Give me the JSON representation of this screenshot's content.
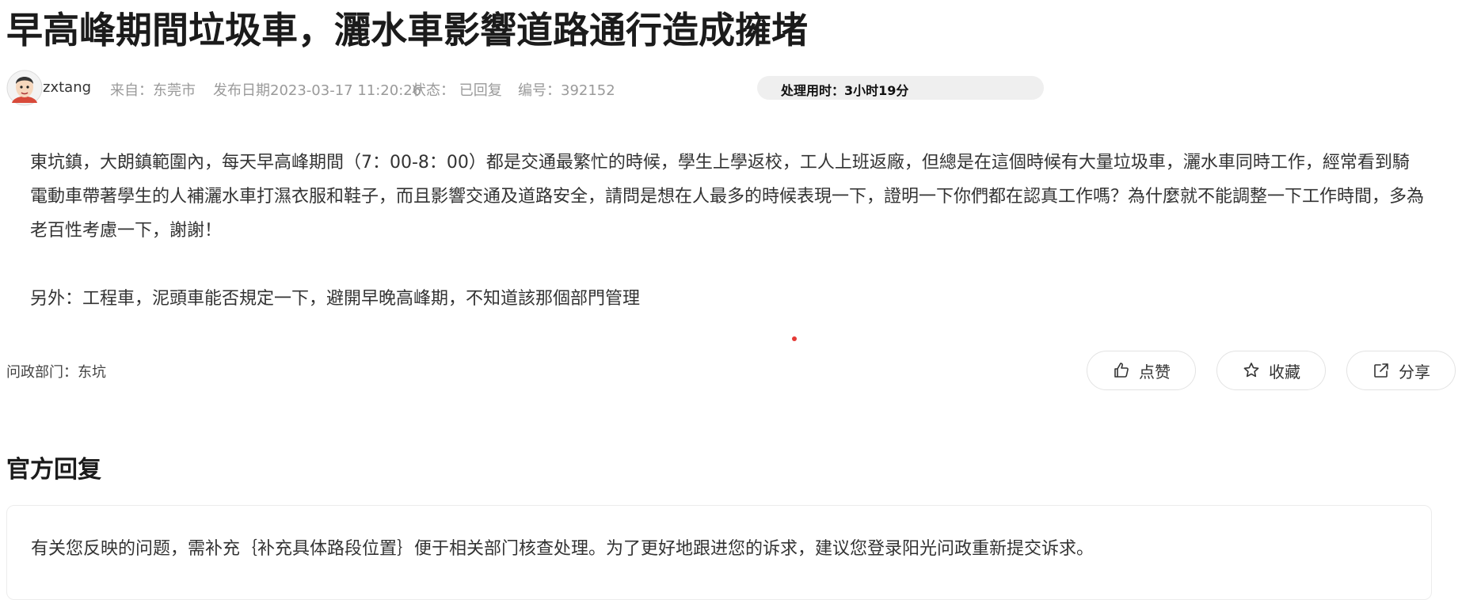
{
  "post": {
    "title": "早高峰期間垃圾車，灑水車影響道路通行造成擁堵",
    "author": "zxtang",
    "from": "来自：东莞市",
    "published": "发布日期2023-03-17 11:20:26",
    "status": "状态： 已回复",
    "number": "编号：392152",
    "duration": "处理用时：3小时19分",
    "body_paragraphs": [
      "東坑鎮，大朗鎮範圍內，每天早高峰期間（7：00-8：00）都是交通最繁忙的時候，學生上學返校，工人上班返廠，但總是在這個時候有大量垃圾車，灑水車同時工作，經常看到騎電動車帶著學生的人補灑水車打濕衣服和鞋子，而且影響交通及道路安全，請問是想在人最多的時候表現一下，證明一下你們都在認真工作嗎？為什麼就不能調整一下工作時間，多為老百性考慮一下，謝謝！",
      "另外：工程車，泥頭車能否規定一下，避開早晚高峰期，不知道該那個部門管理"
    ],
    "department": "问政部门：东坑"
  },
  "actions": {
    "like_label": "点赞",
    "favorite_label": "收藏",
    "share_label": "分享"
  },
  "reply": {
    "section_title": "官方回复",
    "text": "有关您反映的问题，需补充｛补充具体路段位置｝便于相关部门核查处理。为了更好地跟进您的诉求，建议您登录阳光问政重新提交诉求。"
  },
  "icons": [
    "avatar",
    "thumbs-up-icon",
    "star-icon",
    "share-icon"
  ],
  "colors": {
    "accent_dot": "#e53935",
    "pill_bg": "#efefef"
  }
}
